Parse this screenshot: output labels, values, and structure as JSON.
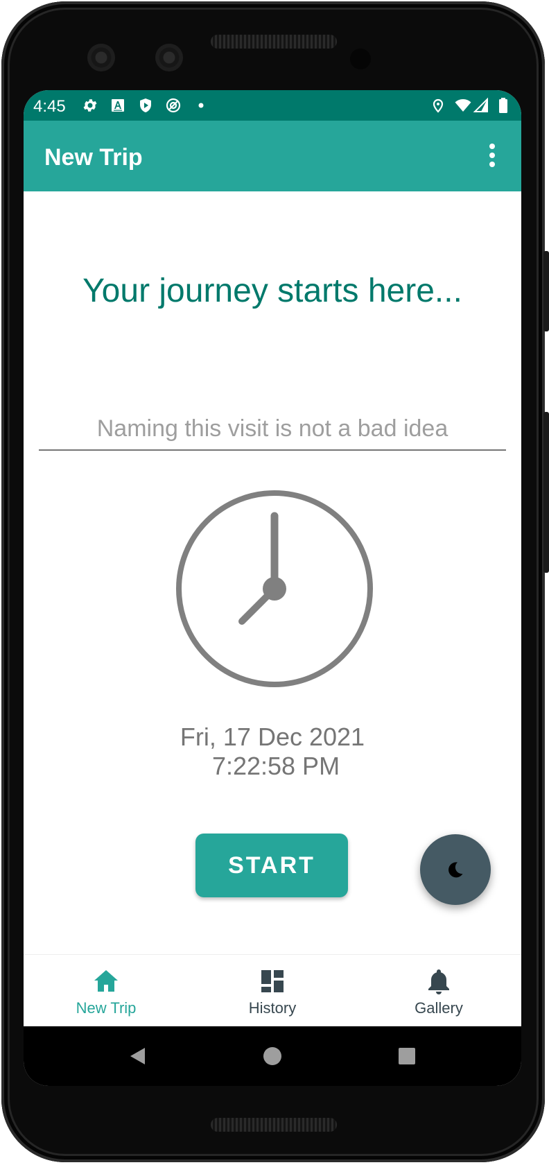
{
  "status_bar": {
    "time": "4:45",
    "left_icons": [
      "settings-icon",
      "text-a-icon",
      "shield-play-icon",
      "no-location-icon",
      "dot-icon"
    ],
    "right_icons": [
      "location-pin-icon",
      "wifi-icon",
      "signal-icon",
      "battery-icon"
    ]
  },
  "app_bar": {
    "title": "New Trip",
    "menu_icon": "overflow-menu-icon"
  },
  "main": {
    "headline": "Your journey starts here...",
    "name_input": {
      "placeholder": "Naming this visit is not a bad idea",
      "value": ""
    },
    "clock_icon": "clock-icon",
    "date": "Fri, 17 Dec 2021",
    "time": "7:22:58 PM",
    "start_button": "START",
    "fab_icon": "moon-icon"
  },
  "bottom_nav": {
    "items": [
      {
        "label": "New Trip",
        "icon": "home-icon",
        "active": true
      },
      {
        "label": "History",
        "icon": "dashboard-icon",
        "active": false
      },
      {
        "label": "Gallery",
        "icon": "bell-icon",
        "active": false
      }
    ]
  },
  "system_nav": [
    "back-icon",
    "home-circle-icon",
    "recents-icon"
  ],
  "colors": {
    "primary": "#26a69a",
    "primary_dark": "#00796b",
    "fab": "#455a64",
    "text_secondary": "#757575"
  }
}
